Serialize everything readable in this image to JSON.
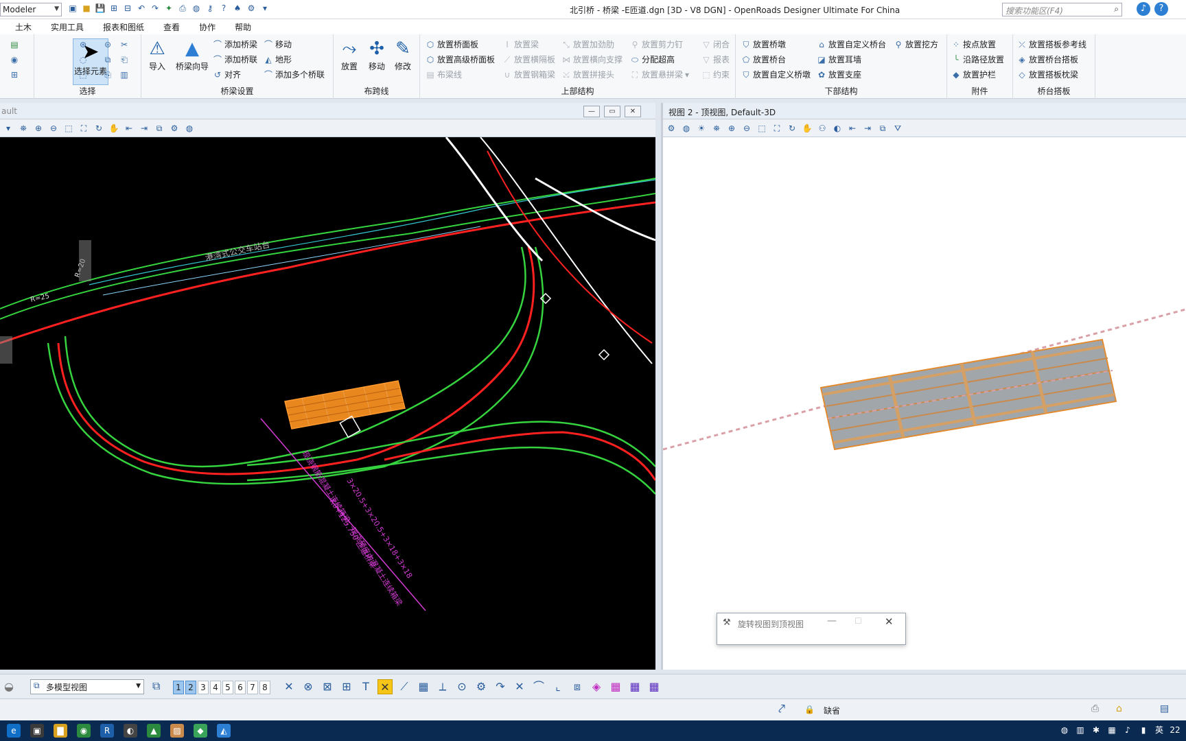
{
  "titlebar": {
    "workspace": "Modeler",
    "title": "北引桥 - 桥梁 -E匝道.dgn [3D - V8 DGN] - OpenRoads Designer Ultimate For China",
    "search_placeholder": "搜索功能区(F4)"
  },
  "menu_tabs": [
    "土木",
    "实用工具",
    "报表和图纸",
    "查看",
    "协作",
    "帮助"
  ],
  "ribbon": {
    "select": {
      "label": "选择",
      "big": "选择元素"
    },
    "bridge_setup": {
      "label": "桥梁设置",
      "import": "导入",
      "wizard": "桥梁向导",
      "add_bridge": "添加桥梁",
      "add_bridge_link": "添加桥联",
      "align": "对齐",
      "move": "移动",
      "terrain": "地形",
      "add_multiple": "添加多个桥联"
    },
    "span_line": {
      "label": "布跨线",
      "place": "放置",
      "move": "移动",
      "modify": "修改"
    },
    "superstructure": {
      "label": "上部结构",
      "items": [
        "放置桥面板",
        "放置高级桥面板",
        "布梁线",
        "放置梁",
        "放置横隔板",
        "放置钢箱梁",
        "放置加劲肋",
        "放置横向支撑",
        "放置拼接头",
        "放置剪力钉",
        "分配超高",
        "放置悬拼梁",
        "闭合",
        "报表",
        "约束"
      ]
    },
    "substructure": {
      "label": "下部结构",
      "items": [
        "放置桥墩",
        "放置桥台",
        "放置自定义桥墩",
        "放置自定义桥台",
        "放置耳墙",
        "放置支座",
        "放置挖方"
      ]
    },
    "attachments": {
      "label": "附件",
      "items": [
        "按点放置",
        "沿路径放置",
        "放置护栏"
      ]
    },
    "approach_slab": {
      "label": "桥台搭板",
      "items": [
        "放置搭板参考线",
        "放置桥台搭板",
        "放置搭板枕梁"
      ]
    }
  },
  "view1": {
    "name": "ault",
    "annotations": {
      "bus_stop": "港湾式公交车站台",
      "r25": "R=25",
      "r20": "R=20",
      "span_note": "3×20.5+3×20.5+3×18+3×18",
      "mileage": "K0+125.750 匝道桥梁",
      "deck_note": "现浇钢筋混凝土连续箱梁，现浇预应力混凝土连续箱梁"
    }
  },
  "view2": {
    "name": "视图 2 - 顶视图, Default-3D"
  },
  "dialog": {
    "title": "旋转视图到顶视图"
  },
  "bottom_toolbar": {
    "model_view": "多模型视图",
    "view_numbers": [
      "1",
      "2",
      "3",
      "4",
      "5",
      "6",
      "7",
      "8"
    ]
  },
  "statusbar": {
    "level": "缺省"
  },
  "tray": {
    "ime": "英",
    "time": "22"
  }
}
